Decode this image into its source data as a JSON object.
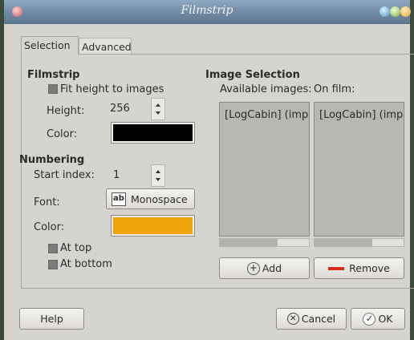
{
  "window": {
    "title": "Filmstrip"
  },
  "tabs": [
    {
      "label": "Selection"
    },
    {
      "label": "Advanced"
    }
  ],
  "filmstrip": {
    "heading": "Filmstrip",
    "fit_height_label": "Fit height to images",
    "height_label": "Height:",
    "height_value": "256",
    "color_label": "Color:",
    "color": "#000000"
  },
  "numbering": {
    "heading": "Numbering",
    "start_index_label": "Start index:",
    "start_index_value": "1",
    "font_label": "Font:",
    "font_value": "Monospace",
    "color_label": "Color:",
    "color": "#f0a30a",
    "at_top_label": "At top",
    "at_bottom_label": "At bottom"
  },
  "image_selection": {
    "heading": "Image Selection",
    "available_label": "Available images:",
    "on_film_label": "On film:",
    "available_items": [
      "[LogCabin] (impo"
    ],
    "on_film_items": [
      "[LogCabin] (impo"
    ],
    "add_label": "Add",
    "remove_label": "Remove"
  },
  "footer": {
    "help_label": "Help",
    "cancel_label": "Cancel",
    "ok_label": "OK"
  },
  "colors": {
    "titlebar": "#6f89a4",
    "window_bg": "#d6d4cf",
    "list_bg": "#b9b7b4",
    "remove_icon": "#d92a1f"
  }
}
